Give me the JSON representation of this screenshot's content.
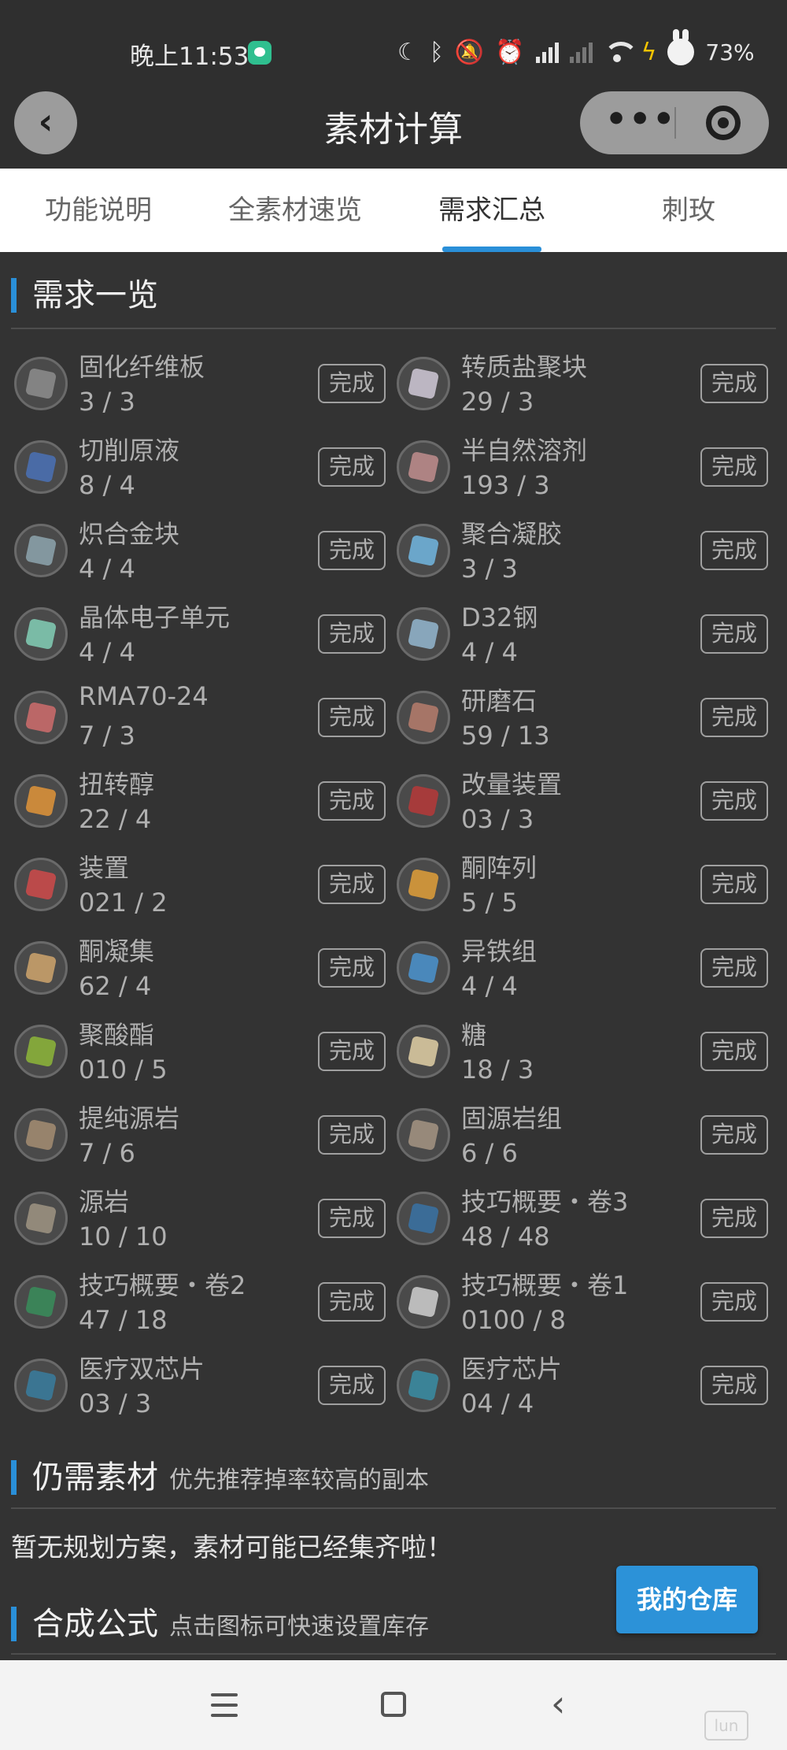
{
  "status_bar": {
    "time": "晚上11:53",
    "battery": "73%"
  },
  "nav": {
    "back_glyph": "‹",
    "title": "素材计算"
  },
  "tabs": [
    {
      "label": "功能说明",
      "active": false
    },
    {
      "label": "全素材速览",
      "active": false
    },
    {
      "label": "需求汇总",
      "active": true
    },
    {
      "label": "刺玫",
      "active": false
    }
  ],
  "sections": {
    "demand": {
      "title": "需求一览"
    },
    "remaining": {
      "title": "仍需素材",
      "subtitle": "优先推荐掉率较高的副本",
      "empty_text": "暂无规划方案，素材可能已经集齐啦！"
    },
    "formula": {
      "title": "合成公式",
      "subtitle": "点击图标可快速设置库存"
    }
  },
  "done_label": "完成",
  "items": [
    {
      "name": "固化纤维板",
      "count": "3 / 3",
      "color": "#8a8a8a"
    },
    {
      "name": "转质盐聚块",
      "count": "29 / 3",
      "color": "#c9c2cf"
    },
    {
      "name": "切削原液",
      "count": "8 / 4",
      "color": "#4a6fb0"
    },
    {
      "name": "半自然溶剂",
      "count": "193 / 3",
      "color": "#b98a8a"
    },
    {
      "name": "炽合金块",
      "count": "4 / 4",
      "color": "#8aa0a8"
    },
    {
      "name": "聚合凝胶",
      "count": "3 / 3",
      "color": "#6fb0d8"
    },
    {
      "name": "晶体电子单元",
      "count": "4 / 4",
      "color": "#7fc8b0"
    },
    {
      "name": "D32钢",
      "count": "4 / 4",
      "color": "#8fb0c8"
    },
    {
      "name": "RMA70-24",
      "count": "7 / 3",
      "color": "#c86a6a"
    },
    {
      "name": "研磨石",
      "count": "59 / 13",
      "color": "#b07a6a"
    },
    {
      "name": "扭转醇",
      "count": "22 / 4",
      "color": "#d8903a"
    },
    {
      "name": "改量装置",
      "count": "03 / 3",
      "color": "#b03a3a"
    },
    {
      "name": "装置",
      "count": "021 / 2",
      "color": "#c84a4a"
    },
    {
      "name": "酮阵列",
      "count": "5 / 5",
      "color": "#d89a3a"
    },
    {
      "name": "酮凝集",
      "count": "62 / 4",
      "color": "#c8a06a"
    },
    {
      "name": "异铁组",
      "count": "4 / 4",
      "color": "#4a8fc8"
    },
    {
      "name": "聚酸酯",
      "count": "010 / 5",
      "color": "#8ab03a"
    },
    {
      "name": "糖",
      "count": "18 / 3",
      "color": "#d8c8a0"
    },
    {
      "name": "提纯源岩",
      "count": "7 / 6",
      "color": "#a08a70"
    },
    {
      "name": "固源岩组",
      "count": "6 / 6",
      "color": "#a09080"
    },
    {
      "name": "源岩",
      "count": "10 / 10",
      "color": "#9a9080"
    },
    {
      "name": "技巧概要・卷3",
      "count": "48 / 48",
      "color": "#3a70a0"
    },
    {
      "name": "技巧概要・卷2",
      "count": "47 / 18",
      "color": "#3a8a5a"
    },
    {
      "name": "技巧概要・卷1",
      "count": "0100 / 8",
      "color": "#c8c8c8"
    },
    {
      "name": "医疗双芯片",
      "count": "03 / 3",
      "color": "#3a7a9a"
    },
    {
      "name": "医疗芯片",
      "count": "04 / 4",
      "color": "#3a8aa0"
    }
  ],
  "buttons": {
    "warehouse": "我的仓库"
  },
  "watermark": "lun"
}
